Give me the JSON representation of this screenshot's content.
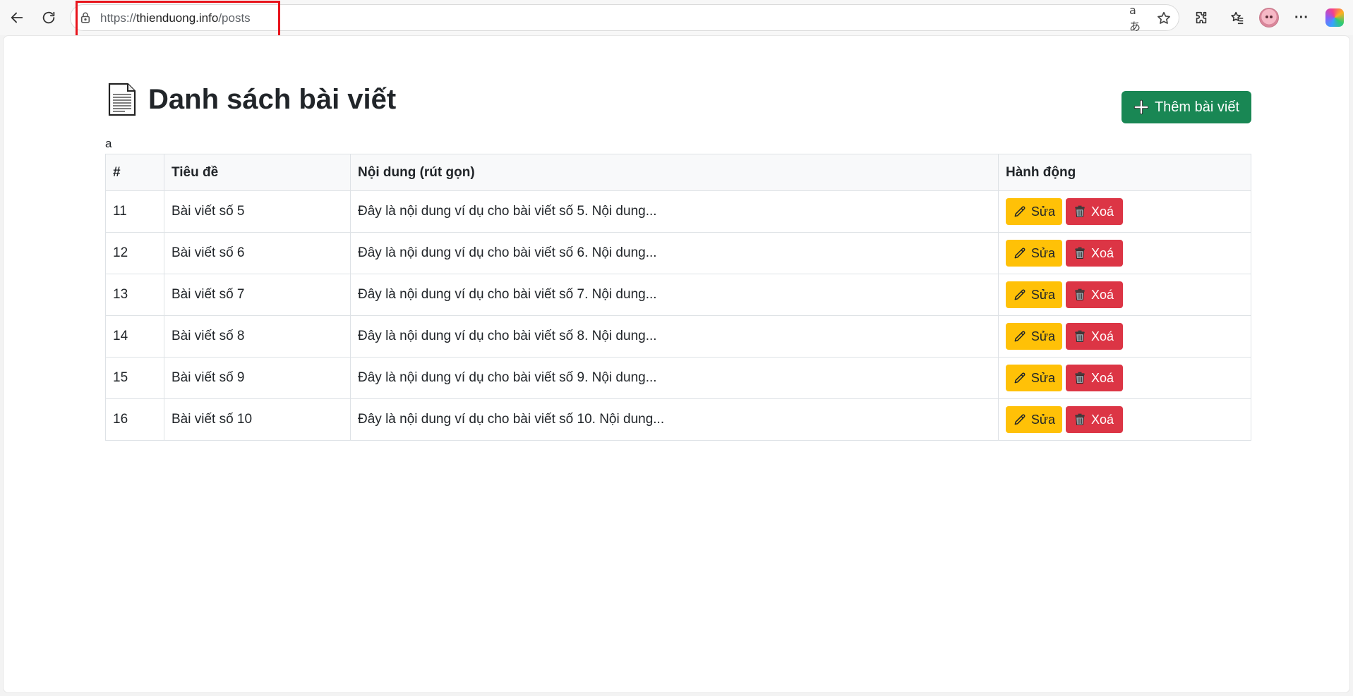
{
  "browser": {
    "url_scheme": "https://",
    "url_host": "thienduong.info",
    "url_path": "/posts",
    "icons": [
      "back-icon",
      "refresh-icon",
      "lock-icon",
      "translate-icon",
      "star-icon",
      "extensions-icon",
      "favorites-icon",
      "profile-avatar",
      "more-icon",
      "copilot-icon"
    ],
    "translate_glyph": "aあ",
    "more_glyph": "···"
  },
  "page": {
    "title": "Danh sách bài viết",
    "add_button_label": "Thêm bài viết",
    "stray_text": "a",
    "accent_colors": {
      "add": "#198754",
      "edit": "#ffc107",
      "delete": "#dc3545"
    }
  },
  "table": {
    "headers": [
      "#",
      "Tiêu đề",
      "Nội dung (rút gọn)",
      "Hành động"
    ],
    "edit_label": "Sửa",
    "delete_label": "Xoá",
    "rows": [
      {
        "id": "11",
        "title": "Bài viết số 5",
        "content": "Đây là nội dung ví dụ cho bài viết số 5. Nội dung..."
      },
      {
        "id": "12",
        "title": "Bài viết số 6",
        "content": "Đây là nội dung ví dụ cho bài viết số 6. Nội dung..."
      },
      {
        "id": "13",
        "title": "Bài viết số 7",
        "content": "Đây là nội dung ví dụ cho bài viết số 7. Nội dung..."
      },
      {
        "id": "14",
        "title": "Bài viết số 8",
        "content": "Đây là nội dung ví dụ cho bài viết số 8. Nội dung..."
      },
      {
        "id": "15",
        "title": "Bài viết số 9",
        "content": "Đây là nội dung ví dụ cho bài viết số 9. Nội dung..."
      },
      {
        "id": "16",
        "title": "Bài viết số 10",
        "content": "Đây là nội dung ví dụ cho bài viết số 10. Nội dung..."
      }
    ]
  }
}
